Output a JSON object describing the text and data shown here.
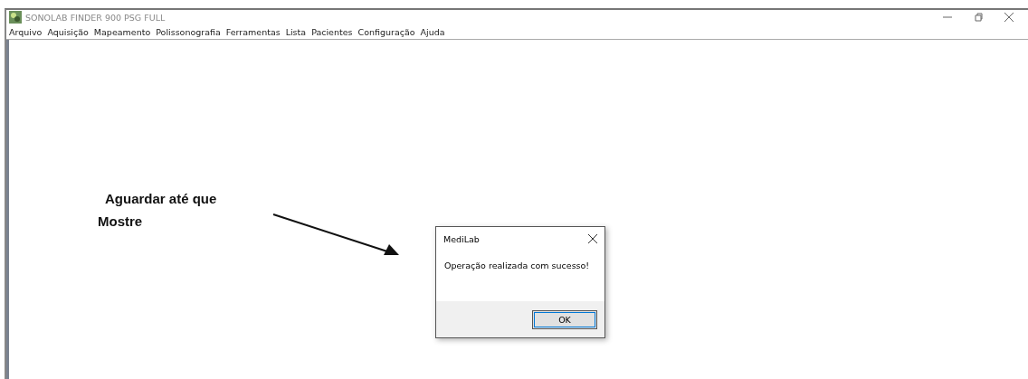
{
  "window": {
    "title": "SONOLAB FINDER 900 PSG FULL"
  },
  "menu": [
    "Arquivo",
    "Aquisição",
    "Mapeamento",
    "Polissonografia",
    "Ferramentas",
    "Lista",
    "Pacientes",
    "Configuração",
    "Ajuda"
  ],
  "annotation": {
    "lines": [
      "Aguardar até que",
      "Mostre"
    ]
  },
  "dialog": {
    "title": "MediLab",
    "message": "Operação realizada com sucesso!",
    "buttons": [
      "OK"
    ]
  }
}
